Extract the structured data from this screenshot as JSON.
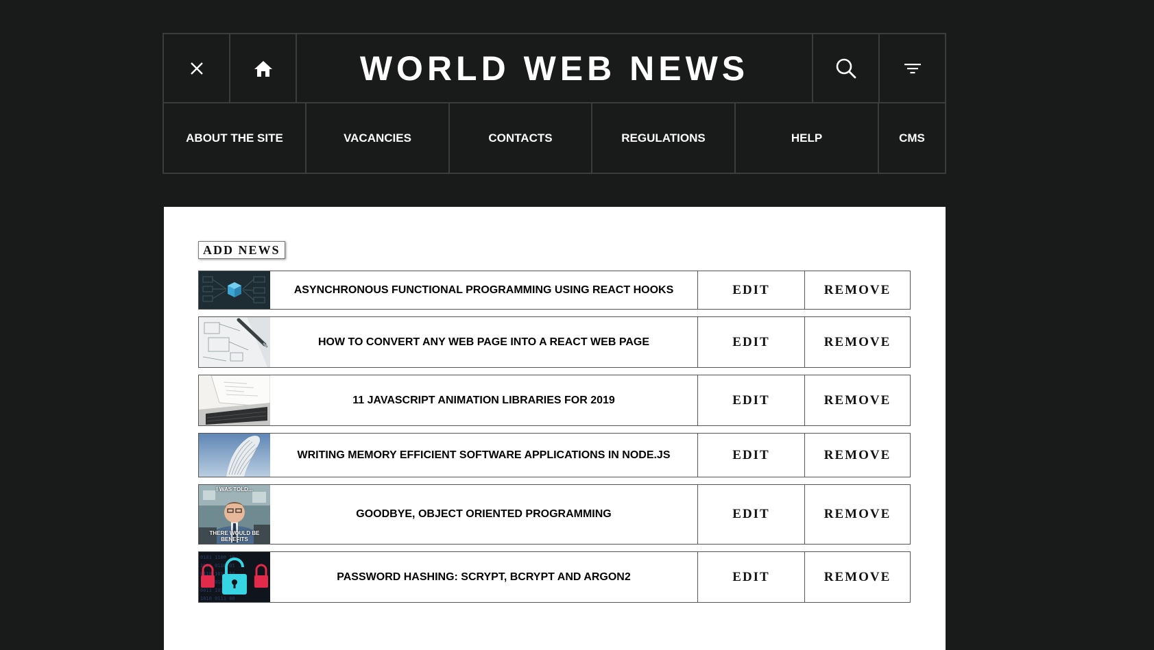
{
  "header": {
    "title": "WORLD WEB NEWS",
    "icons": [
      "close-icon",
      "home-icon",
      "search-icon",
      "filter-icon"
    ]
  },
  "nav": {
    "items": [
      {
        "label": "ABOUT THE SITE"
      },
      {
        "label": "VACANCIES"
      },
      {
        "label": "CONTACTS"
      },
      {
        "label": "REGULATIONS"
      },
      {
        "label": "HELP"
      },
      {
        "label": "CMS"
      }
    ]
  },
  "main": {
    "add_label": "ADD NEWS",
    "edit_label": "EDIT",
    "remove_label": "REMOVE",
    "news": [
      {
        "title": "ASYNCHRONOUS FUNCTIONAL PROGRAMMING USING REACT HOOKS"
      },
      {
        "title": "HOW TO CONVERT ANY WEB PAGE INTO A REACT WEB PAGE"
      },
      {
        "title": "11 JAVASCRIPT ANIMATION LIBRARIES FOR 2019"
      },
      {
        "title": "WRITING MEMORY EFFICIENT SOFTWARE APPLICATIONS IN NODE.JS"
      },
      {
        "title": "GOODBYE, OBJECT ORIENTED PROGRAMMING",
        "thumb_caption_top": "I WAS TOLD...",
        "thumb_caption_bottom": "THERE WOULD BE BENEFITS"
      },
      {
        "title": "PASSWORD HASHING: SCRYPT, BCRYPT AND ARGON2"
      }
    ]
  },
  "colors": {
    "page_bg": "#191b1b",
    "border": "#3a3d3d",
    "panel_bg": "#ffffff"
  }
}
